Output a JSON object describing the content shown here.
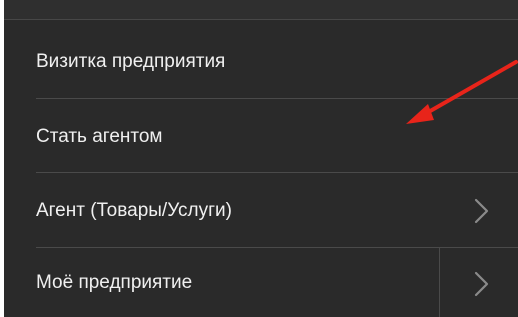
{
  "menu": {
    "items": [
      {
        "label": "Визитка предприятия",
        "has_submenu": false
      },
      {
        "label": "Стать агентом",
        "has_submenu": false
      },
      {
        "label": "Агент (Товары/Услуги)",
        "has_submenu": true
      },
      {
        "label": "Моё предприятие",
        "has_submenu": true
      }
    ]
  },
  "colors": {
    "menu_background": "#2a2a2a",
    "text": "#f0f0f0",
    "divider": "#4a4a4a",
    "chevron": "#8a8a8a",
    "annotation_arrow": "#e8241a"
  },
  "icons": {
    "submenu_chevron": "chevron-right-icon",
    "annotation": "red-arrow-annotation"
  }
}
